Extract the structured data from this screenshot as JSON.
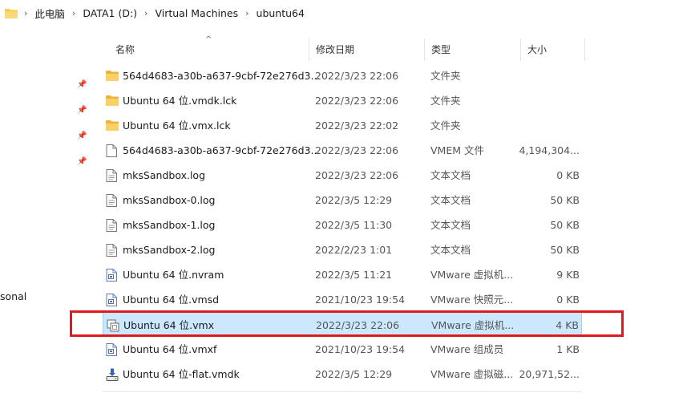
{
  "breadcrumb": [
    "此电脑",
    "DATA1 (D:)",
    "Virtual Machines",
    "ubuntu64"
  ],
  "columns": {
    "name": "名称",
    "date": "修改日期",
    "type": "类型",
    "size": "大小"
  },
  "left_pane": {
    "partial_label": "sonal"
  },
  "files": [
    {
      "name": "564d4683-a30b-a637-9cbf-72e276d3...",
      "date": "2022/3/23 22:06",
      "type": "文件夹",
      "size": "",
      "icon": "folder-icon"
    },
    {
      "name": "Ubuntu 64 位.vmdk.lck",
      "date": "2022/3/23 22:06",
      "type": "文件夹",
      "size": "",
      "icon": "folder-icon"
    },
    {
      "name": "Ubuntu 64 位.vmx.lck",
      "date": "2022/3/23 22:02",
      "type": "文件夹",
      "size": "",
      "icon": "folder-icon"
    },
    {
      "name": "564d4683-a30b-a637-9cbf-72e276d3...",
      "date": "2022/3/23 22:06",
      "type": "VMEM 文件",
      "size": "4,194,304...",
      "icon": "file-icon"
    },
    {
      "name": "mksSandbox.log",
      "date": "2022/3/23 22:06",
      "type": "文本文档",
      "size": "0 KB",
      "icon": "text-file-icon"
    },
    {
      "name": "mksSandbox-0.log",
      "date": "2022/3/5 12:29",
      "type": "文本文档",
      "size": "50 KB",
      "icon": "text-file-icon"
    },
    {
      "name": "mksSandbox-1.log",
      "date": "2022/3/5 11:30",
      "type": "文本文档",
      "size": "50 KB",
      "icon": "text-file-icon"
    },
    {
      "name": "mksSandbox-2.log",
      "date": "2022/2/23 1:01",
      "type": "文本文档",
      "size": "50 KB",
      "icon": "text-file-icon"
    },
    {
      "name": "Ubuntu 64 位.nvram",
      "date": "2022/3/5 11:21",
      "type": "VMware 虚拟机...",
      "size": "9 KB",
      "icon": "vmware-file-icon"
    },
    {
      "name": "Ubuntu 64 位.vmsd",
      "date": "2021/10/23 19:54",
      "type": "VMware 快照元...",
      "size": "0 KB",
      "icon": "vmware-file-icon"
    },
    {
      "name": "Ubuntu 64 位.vmx",
      "date": "2022/3/23 22:06",
      "type": "VMware 虚拟机...",
      "size": "4 KB",
      "icon": "vmware-vm-icon",
      "selected": true
    },
    {
      "name": "Ubuntu 64 位.vmxf",
      "date": "2021/10/23 19:54",
      "type": "VMware 组成员",
      "size": "1 KB",
      "icon": "vmware-file-icon"
    },
    {
      "name": "Ubuntu 64 位-flat.vmdk",
      "date": "2022/3/5 12:29",
      "type": "VMware 虚拟磁...",
      "size": "20,971,52...",
      "icon": "vmware-disk-icon"
    }
  ],
  "colors": {
    "selection_bg": "#cce8ff",
    "selection_border": "#99d1ff",
    "highlight_box": "#e0181f",
    "folder": "#f6c95b"
  }
}
